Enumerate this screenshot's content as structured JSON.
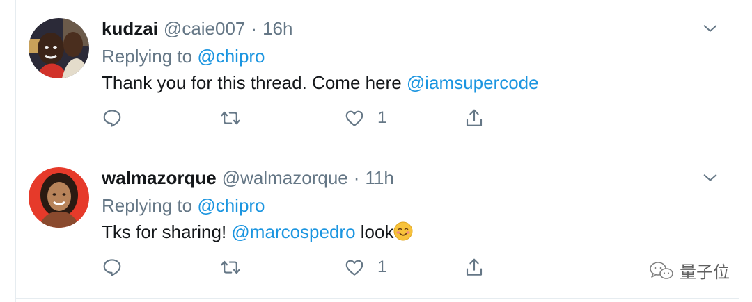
{
  "tweets": [
    {
      "name": "kudzai",
      "handle": "@caie007",
      "separator": "·",
      "time": "16h",
      "replying_prefix": "Replying to",
      "replying_to": "@chipro",
      "text": "Thank you for this thread. Come here ",
      "text_mention": "@iamsupercode",
      "text_after": "",
      "like_count": "1"
    },
    {
      "name": "walmazorque",
      "handle": "@walmazorque",
      "separator": "·",
      "time": "11h",
      "replying_prefix": "Replying to",
      "replying_to": "@chipro",
      "text": "Tks for sharing! ",
      "text_mention": "@marcospedro",
      "text_after": " look",
      "like_count": "1"
    }
  ],
  "watermark": {
    "text": "量子位"
  },
  "icons": {
    "reply": "speech-bubble-icon",
    "retweet": "retweet-arrows-icon",
    "like": "heart-icon",
    "share": "share-upload-icon",
    "menu": "chevron-down-icon",
    "emoji": "smiling-face-emoji-icon",
    "watermark": "wechat-icon"
  },
  "colors": {
    "mention": "#1b95e0",
    "secondary_text": "#657786",
    "divider": "#e6ecf0",
    "primary_text": "#14171a"
  }
}
